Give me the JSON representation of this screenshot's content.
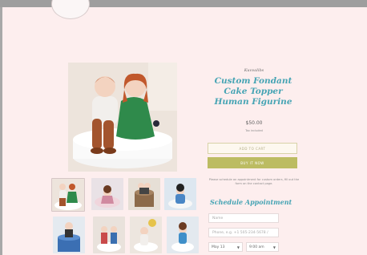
{
  "product": {
    "brand": "Kuvvalibs",
    "title": "Custom Fondant Cake Topper Human Figurine",
    "price": "$50.00",
    "tax_note": "Tax included",
    "add_to_cart": "ADD TO CART",
    "buy_now": "BUY IT NOW",
    "note": "Please schedule an appointment for custom orders, fill out the form on the contact page."
  },
  "schedule": {
    "heading": "Schedule Appointment",
    "name_placeholder": "Name",
    "phone_placeholder": "Phone, e.g. +1 505-234-5678 /",
    "date_value": "May 13",
    "time_value": "9:00 am"
  },
  "gallery": {
    "thumbnail_count": 8,
    "selected_index": 0
  },
  "colors": {
    "accent": "#46a4b4",
    "buy_button": "#bcbc62",
    "background": "#fdeeee"
  }
}
